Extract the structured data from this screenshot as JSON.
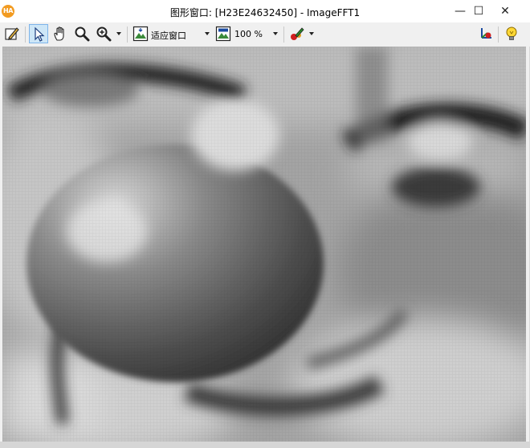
{
  "window": {
    "title": "图形窗口: [H23E24632450] - ImageFFT1",
    "app_icon_text": "HA",
    "controls": {
      "minimize": "—",
      "maximize": "☐",
      "close": "✕"
    }
  },
  "toolbar": {
    "fit_label": "适应窗口",
    "zoom_label": "100  %",
    "tools": [
      {
        "icon": "edit-pencil-icon"
      },
      {
        "icon": "pointer-arrow-icon",
        "active": true
      },
      {
        "icon": "pan-hand-icon"
      },
      {
        "icon": "magnify-icon"
      },
      {
        "icon": "zoom-in-icon"
      },
      {
        "icon": "fit-window-icon"
      },
      {
        "icon": "zoom-percent-icon"
      },
      {
        "icon": "color-paint-icon"
      },
      {
        "icon": "axes-3d-icon"
      },
      {
        "icon": "lightbulb-icon"
      }
    ]
  },
  "image": {
    "name": "ImageFFT1",
    "style": "grayscale"
  },
  "colors": {
    "title_bg": "#ffffff",
    "toolbar_bg": "#f0f0f0",
    "active_tool_bg": "#cde6f7",
    "app_icon": "#f29b21"
  }
}
